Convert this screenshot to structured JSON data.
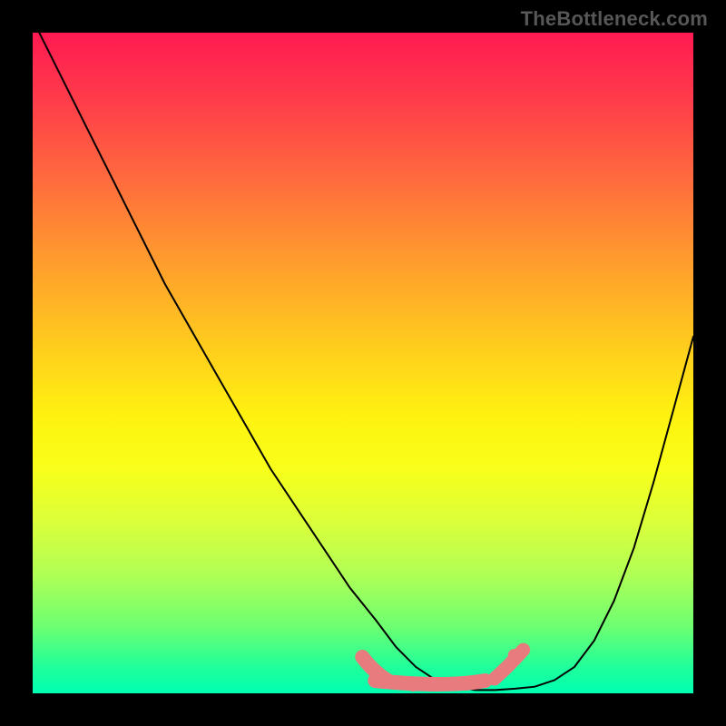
{
  "watermark": "TheBottleneck.com",
  "colors": {
    "background": "#000000",
    "curve": "#000000",
    "highlight": "#e87b7e",
    "gradient_top": "#ff1a52",
    "gradient_bottom": "#00ffb2"
  },
  "chart_data": {
    "type": "line",
    "title": "",
    "xlabel": "",
    "ylabel": "",
    "xlim": [
      0,
      100
    ],
    "ylim": [
      0,
      100
    ],
    "series": [
      {
        "name": "curve",
        "x": [
          0,
          4,
          8,
          12,
          16,
          20,
          24,
          28,
          32,
          36,
          40,
          44,
          48,
          52,
          55,
          58,
          61,
          64,
          67,
          70,
          73,
          76,
          79,
          82,
          85,
          88,
          91,
          94,
          97,
          100
        ],
        "y": [
          102,
          94,
          86,
          78,
          70,
          62,
          55,
          48,
          41,
          34,
          28,
          22,
          16,
          11,
          7,
          4,
          2,
          1,
          0.5,
          0.5,
          0.7,
          1.0,
          2.0,
          4.0,
          8.0,
          14.0,
          22.0,
          32.0,
          43.0,
          54.0
        ]
      }
    ],
    "highlight_range_x": [
      51,
      74
    ],
    "highlight_y": 1
  }
}
